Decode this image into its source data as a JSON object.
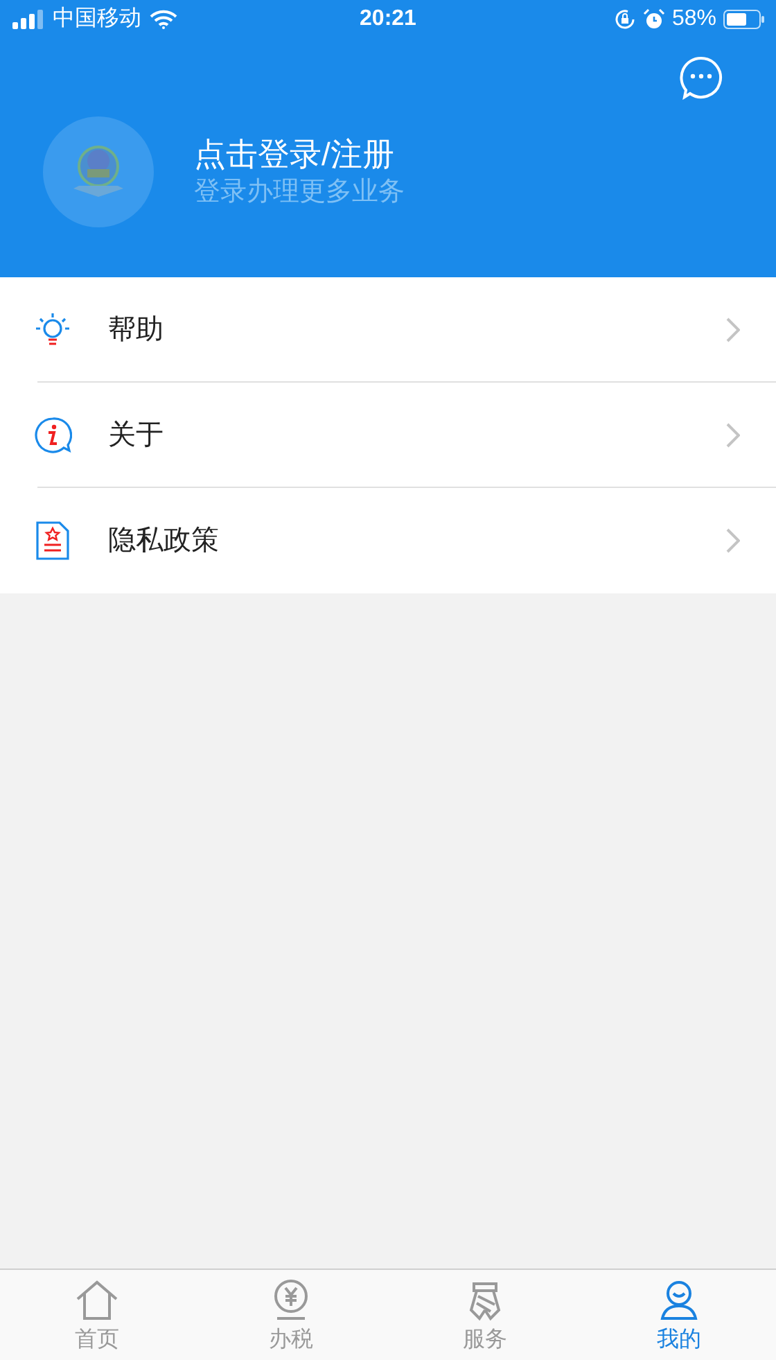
{
  "status_bar": {
    "carrier": "中国移动",
    "time": "20:21",
    "battery": "58%"
  },
  "header": {
    "title": "点击登录/注册",
    "subtitle": "登录办理更多业务"
  },
  "menu": [
    {
      "kind": "bulb",
      "label": "帮助"
    },
    {
      "kind": "info",
      "label": "关于"
    },
    {
      "kind": "document",
      "label": "隐私政策"
    }
  ],
  "tabs": [
    {
      "kind": "home",
      "label": "首页",
      "selected": false
    },
    {
      "kind": "tax",
      "label": "办税",
      "selected": false
    },
    {
      "kind": "service",
      "label": "服务",
      "selected": false
    },
    {
      "kind": "profile",
      "label": "我的",
      "selected": true
    }
  ]
}
